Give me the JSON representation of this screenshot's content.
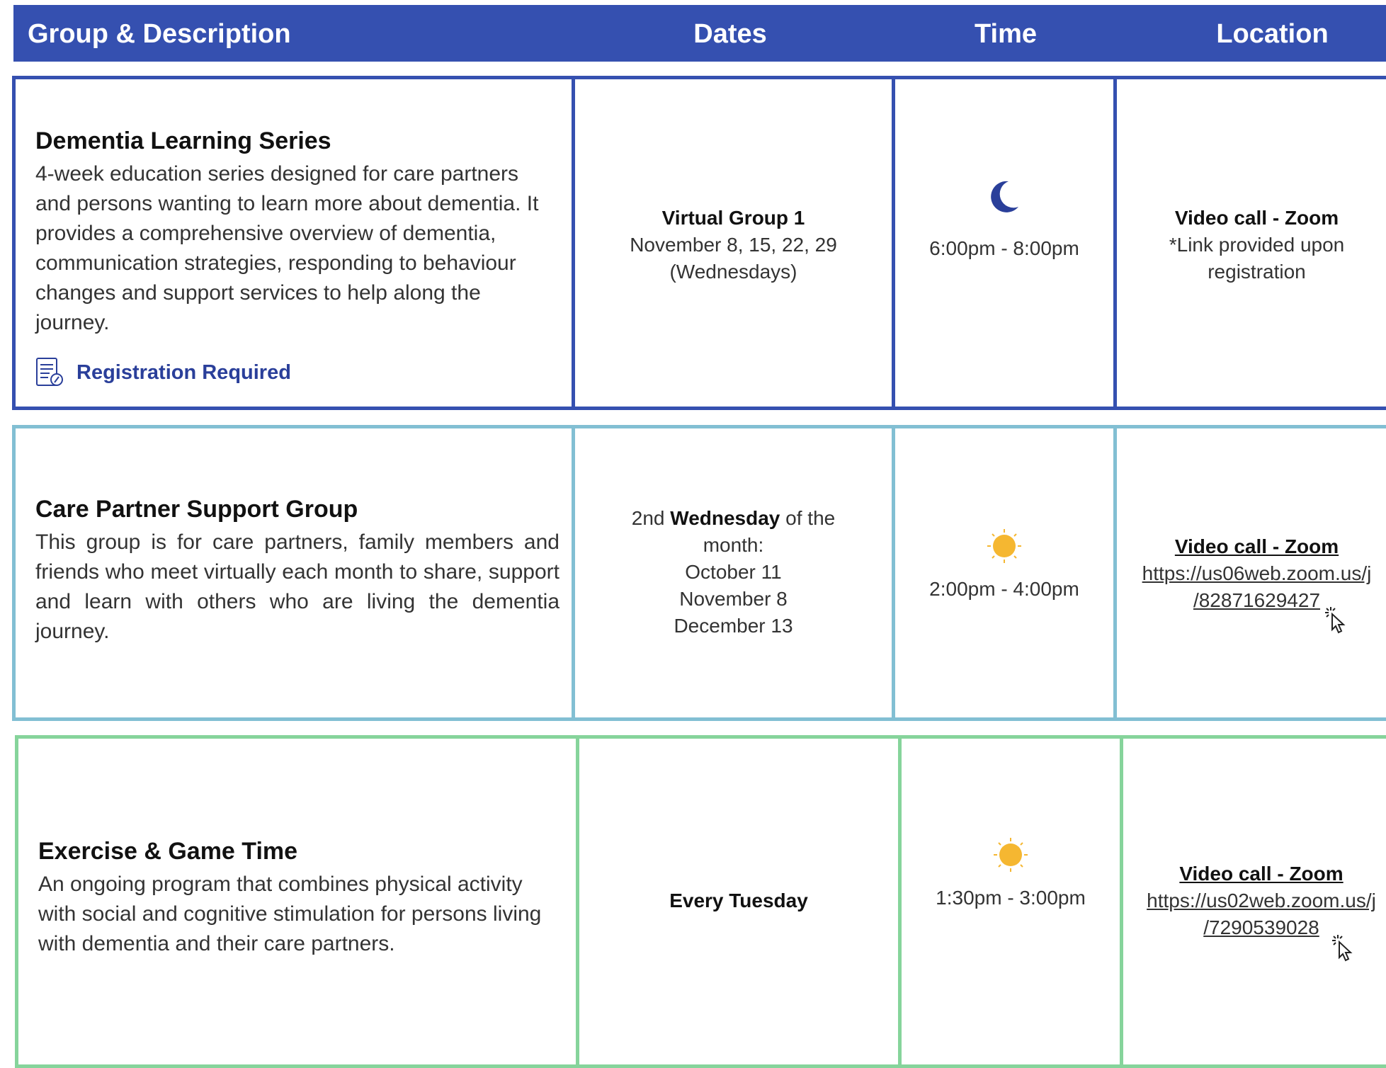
{
  "header": {
    "group": "Group & Description",
    "dates": "Dates",
    "time": "Time",
    "location": "Location"
  },
  "rows": [
    {
      "title": "Dementia Learning Series",
      "description": "4-week education series designed for care partners and persons wanting to learn more about dementia. It provides a comprehensive overview of dementia, communication strategies, responding to behaviour changes and support services to help along the journey.",
      "registration": "Registration Required",
      "dates_title": "Virtual Group 1",
      "dates_line1": "November 8, 15, 22, 29",
      "dates_line2": "(Wednesdays)",
      "time_icon": "moon-icon",
      "time": "6:00pm - 8:00pm",
      "location_title": "Video call - Zoom",
      "location_line1": "*Link provided upon",
      "location_line2": "registration"
    },
    {
      "title": "Care Partner Support Group",
      "description": "This group is for care partners, family members and friends who meet virtually each month to share, support and learn with others who are living the dementia journey.",
      "dates_prefix": "2nd",
      "dates_day": "Wednesday",
      "dates_suffix": "of the",
      "dates_line2": "month:",
      "dates_list": [
        "October 11",
        "November 8",
        "December 13"
      ],
      "time_icon": "sun-icon",
      "time": "2:00pm - 4:00pm",
      "location_title": "Video call - Zoom",
      "location_link1": "https://us06web.zoom.us/j",
      "location_link2": "/82871629427"
    },
    {
      "title": "Exercise & Game Time",
      "description": "An ongoing program that combines physical activity with social and cognitive stimulation for persons living with dementia and their care partners.",
      "dates_title": "Every Tuesday",
      "time_icon": "sun-icon",
      "time": "1:30pm - 3:00pm",
      "location_title": "Video call - Zoom",
      "location_link1": "https://us02web.zoom.us/j",
      "location_link2": "/7290539028"
    }
  ],
  "colors": {
    "header": "#3550b0",
    "row1_border": "#3550b0",
    "row2_border": "#82bfd3",
    "row3_border": "#86d49b",
    "moon": "#2a3f9a",
    "sun": "#f5b731"
  }
}
